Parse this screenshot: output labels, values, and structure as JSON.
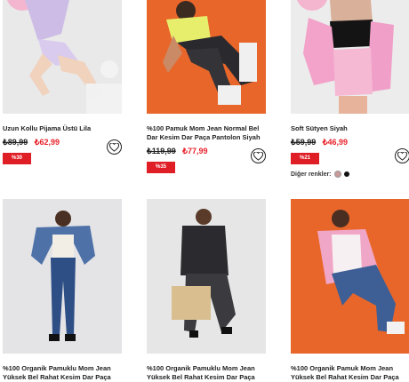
{
  "products": [
    {
      "title": "Uzun Kollu Pijama Üstü Lila",
      "old_price": "₺89,99",
      "new_price": "₺62,99",
      "discount": "%30"
    },
    {
      "title": "%100 Pamuk Mom Jean Normal Bel Dar Kesim Dar Paça Pantolon Siyah",
      "old_price": "₺119,99",
      "new_price": "₺77,99",
      "discount": "%35"
    },
    {
      "title": "Soft Sütyen Siyah",
      "old_price": "₺59,99",
      "new_price": "₺46,99",
      "discount": "%21",
      "other_colors_label": "Diğer renkler:",
      "other_colors": [
        "#c99a9a",
        "#111111"
      ]
    },
    {
      "title": "%100 Organik Pamuklu Mom Jean Yüksek Bel Rahat Kesim Dar Paça"
    },
    {
      "title": "%100 Organik Pamuklu Mom Jean Yüksek Bel Rahat Kesim Dar Paça"
    },
    {
      "title": "%100 Organik Pamuk Mom Jean Yüksek Bel Rahat Kesim Dar Paça"
    }
  ],
  "icons": {
    "favorite": "heart-icon"
  },
  "colors": {
    "price_red": "#e8202a",
    "badge_red": "#e01e26",
    "orange_bg": "#e9662a"
  }
}
